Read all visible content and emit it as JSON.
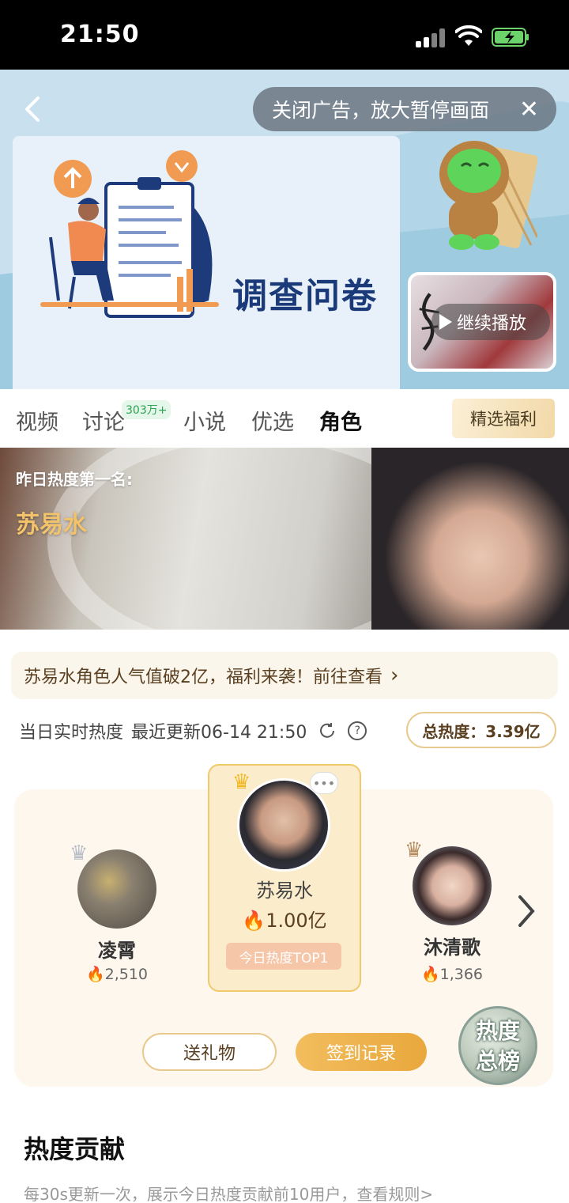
{
  "status_bar": {
    "time": "21:50"
  },
  "ad": {
    "close_label": "关闭广告，放大暂停画面",
    "close_x": "✕",
    "card_title": "调查问卷",
    "continue_play": "继续播放"
  },
  "tabs": [
    {
      "label": "视频"
    },
    {
      "label": "讨论",
      "badge": "303万+"
    },
    {
      "label": "小说"
    },
    {
      "label": "优选"
    },
    {
      "label": "角色"
    }
  ],
  "benefit_button": "精选福利",
  "hero": {
    "caption": "昨日热度第一名:",
    "name": "苏易水"
  },
  "notice": {
    "text": "苏易水角色人气值破2亿，福利来袭！前往查看",
    "chevron": "›"
  },
  "heat": {
    "label": "当日实时热度",
    "updated": "最近更新06-14 21:50",
    "total": "总热度：3.39亿"
  },
  "ranking": [
    {
      "rank": 1,
      "name": "苏易水",
      "score": "1.00亿",
      "badge": "今日热度TOP1"
    },
    {
      "rank": 2,
      "name": "凌霄",
      "score": "2,510"
    },
    {
      "rank": 3,
      "name": "沐清歌",
      "score": "1,366"
    }
  ],
  "buttons": {
    "gift": "送礼物",
    "checkin": "签到记录",
    "rank_badge_line1": "热度",
    "rank_badge_line2": "总榜"
  },
  "contribution": {
    "title": "热度贡献",
    "desc": "每30s更新一次，展示今日热度贡献前10用户，查看规则>"
  },
  "colors": {
    "accent": "#e9a83c",
    "text_gold": "#f2c36b",
    "badge_green": "#2aa44f"
  }
}
